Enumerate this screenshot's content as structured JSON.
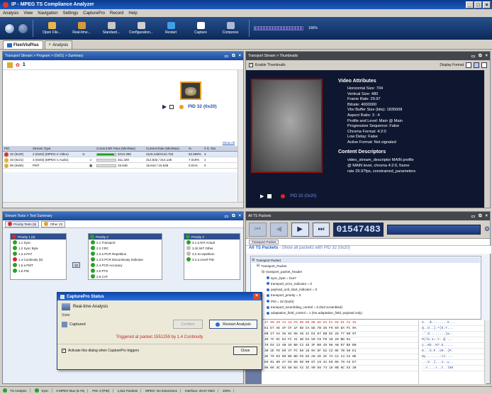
{
  "window": {
    "title": "IP - MPEG TS Compliance Analyzer"
  },
  "menu": [
    "Analysis",
    "View",
    "Navigation",
    "Settings",
    "CapturePro",
    "Record",
    "Help"
  ],
  "toolbar": {
    "buttons": [
      {
        "label": "Open File...",
        "icon": "folder-icon",
        "color": "#e8b64a"
      },
      {
        "label": "Real-time...",
        "icon": "realtime-icon",
        "color": "#d59a3a"
      },
      {
        "label": "Standard...",
        "icon": "standard-icon",
        "color": "#c9c9c9"
      },
      {
        "label": "Configuration...",
        "icon": "configuration-icon",
        "color": "#d0d0d0"
      },
      {
        "label": "Restart",
        "icon": "restart-icon",
        "color": "#3fa0e8"
      },
      {
        "label": "Capture",
        "icon": "capture-icon",
        "color": "#ffffff"
      },
      {
        "label": "Compress",
        "icon": "compress-icon",
        "color": "#aeb9d6"
      }
    ],
    "progress_label": "100%"
  },
  "view_tabs": [
    {
      "label": "FlexiViuPlus"
    },
    {
      "label": "Analysis"
    }
  ],
  "summary_panel": {
    "title": "Transport Stream > Program > (0x01) > Summary",
    "program_number": "1",
    "pid_label": "PID 32 (0x20)",
    "show_all": "Show All",
    "columns": [
      "PID",
      "Stream Type",
      "",
      "",
      "Current BR Pass (Min/Max)",
      "Current Rate (Min/Max)",
      "%",
      "# S. Stats"
    ],
    "rows": [
      {
        "status": "#d03a2a",
        "pid": "32 (0x20)",
        "type": "2 (0x02) (MPEG-2 Video)",
        "br": "4013.368",
        "rate": "4115.448/4122.704",
        "pct": "92.599%",
        "cnt": "4"
      },
      {
        "status": "#e0b030",
        "pid": "33 (0x21)",
        "type": "3 (0x03) (MPEG-1 Audio)",
        "br": "311.328",
        "rate": "312.832 / 314.136",
        "pct": "7.019%",
        "cnt": "1"
      },
      {
        "status": "#e0b030",
        "pid": "96 (0x60)",
        "type": "PMT",
        "br": "15.648",
        "rate": "15.644 / 15.648",
        "pct": "0.01%",
        "cnt": "0"
      }
    ],
    "bar_fill": 0.93,
    "bar_color": "#1ea01e"
  },
  "thumbs_panel": {
    "title": "Transport Stream > Thumbnails",
    "enable_label": "Enable Thumbnails",
    "display_format": "Display Format",
    "video_heading": "Video Attributes",
    "attrs": [
      "Horizontal Size: 704",
      "Vertical Size: 480",
      "Frame Rate: 29.97",
      "Bitrate: 4000000",
      "Vbv Buffer Size (bits): 1835008",
      "Aspect Ratio: 3 : 4",
      "Profile and Level: Main @ Main",
      "Progressive Sequence: False",
      "Chroma Format: 4:2:0",
      "Low Delay: False",
      "Active Format: Not signaled"
    ],
    "content_heading": "Content Descriptors",
    "descriptor": "video_stream_descriptor MAIN profile @ MAIN level, chroma 4:2:0, frame rate 29.97fps, constrained_parameters",
    "pid_label": "PID 32 (0x20)"
  },
  "stream_tests": {
    "title": "Stream Tests > Test Summary",
    "tabs": [
      "Priority Tests (5)",
      "Other (0)"
    ],
    "prio1_title": "Priority 1 (5)",
    "prio1": [
      {
        "label": "1.1 Sync",
        "color": "#2aa02a"
      },
      {
        "label": "1.2 Sync Byte",
        "color": "#2aa02a"
      },
      {
        "label": "1.3 a PAT",
        "color": "#2aa02a"
      },
      {
        "label": "1.4 Continuity (5)",
        "color": "#d02a2a"
      },
      {
        "label": "1.5 a PMT",
        "color": "#2aa02a"
      },
      {
        "label": "1.6 PID",
        "color": "#2aa02a"
      }
    ],
    "prio2_title": "Priority 2",
    "prio2": [
      {
        "label": "2.1 Transport",
        "color": "#2aa02a"
      },
      {
        "label": "2.2 CRC",
        "color": "#2aa02a"
      },
      {
        "label": "2.3 a PCR Repetition",
        "color": "#2aa02a"
      },
      {
        "label": "2.3 b PCR Discontinuity Indicator",
        "color": "#2aa02a"
      },
      {
        "label": "2.4 PCR Accuracy",
        "color": "#2aa02a"
      },
      {
        "label": "2.5 PTS",
        "color": "#2aa02a"
      },
      {
        "label": "2.6 CAT",
        "color": "#2aa02a"
      }
    ],
    "prio3_title": "Priority 3",
    "prio3": [
      {
        "label": "3.1 a NIT Actual",
        "color": "#2aa02a"
      },
      {
        "label": "3.1b NIT Other",
        "color": "#bbbbbb"
      },
      {
        "label": "3.2 SI repetition",
        "color": "#bbbbbb"
      },
      {
        "label": "3.4 a Unref PID",
        "color": "#2aa02a"
      }
    ],
    "badge": "15"
  },
  "packets_panel": {
    "title": "All TS Packets",
    "counter": "01547483",
    "subtab": "Transport Packet",
    "heading": "All TS Packets",
    "heading_sub": " - Show all packets with PID 32 (0x20)",
    "tree": [
      {
        "text": "Transport Packet",
        "depth": 0,
        "sel": true
      },
      {
        "text": "Transport_Packet",
        "depth": 1
      },
      {
        "text": "transport_packet_header",
        "depth": 2
      },
      {
        "text": "sync_byte = 0x47",
        "depth": 3
      },
      {
        "text": "transport_error_indicator = 0",
        "depth": 3
      },
      {
        "text": "payload_unit_start_indicator = 0",
        "depth": 3
      },
      {
        "text": "transport_priority = 0",
        "depth": 3
      },
      {
        "text": "PID = 32 (0x20)",
        "depth": 3
      },
      {
        "text": "transport_scrambling_control = 0 (Not scrambled)",
        "depth": 3
      },
      {
        "text": "adaptation_field_control = 1 (No adaptation_field, payload only)",
        "depth": 3
      }
    ],
    "hex": [
      {
        "off": "0000",
        "bytes": "47 00 20 14 24 FD 00 00 9B 5D D4 E1 58 01 A1 1E",
        "ascii": "G. .$........X..."
      },
      {
        "off": "0010",
        "bytes": "51 E7 AE 4F CF 1F 5D CA 5E 7B 35 F9 59 8A FC 0A",
        "ascii": "Q..O..].^{5.Y..."
      },
      {
        "off": "0020",
        "bytes": "8B 27 AA 36 0A 85 AD 1C D4 07 EB DC 28 77 80 97",
        "ascii": ".'.6........(w.."
      },
      {
        "off": "0030",
        "bytes": "4D 7C 5C 62 FC 31 3D D4 59 C9 FD 40 20 BD 91",
        "ascii": "M|\\b.1=.Y..@ ..."
      },
      {
        "off": "0040",
        "bytes": "79 D4 13 4B 45 B0 C2 4E 3F B0 45 06 AB 07 B5 B0",
        "ascii": "y..KE..N?.E....."
      },
      {
        "off": "0050",
        "bytes": "30 2E FD 89 47 FC 50 18 0A 6F 52 C2 0E 7B 50 E1",
        "ascii": "0...G.P..oR..{P."
      },
      {
        "off": "0060",
        "bytes": "4E 79 D3 00 B9 BD FD 04 A0 2D 3C 7A C2 14 C2 0E",
        "ascii": "Ny.......-<z...."
      },
      {
        "off": "0070",
        "bytes": "E9 01 80 47 D3 06 5D 09 87 19 31 E0 08 79 A2 E7",
        "ascii": "...G..]...1..y.."
      },
      {
        "off": "0080",
        "bytes": "05 06 3C 03 88 B4 A2 3C 90 98 74 16 0B 6C 53 30",
        "ascii": "..<....<..t..lS0"
      }
    ]
  },
  "dialog": {
    "title": "CapturePro Status",
    "subtitle": "Real-time Analysis",
    "state_label": "State",
    "captured": "Captured",
    "confirm": "Confirm",
    "restart": "Restart Analysis",
    "triggered": "Triggered at packet 1551259 by 1.4 Continuity",
    "activate": "Activate this dialog when CapturePro triggers",
    "close": "Close"
  },
  "statusbar": [
    "TS Analysis",
    "Sync",
    "0 MPEG Mux (6.76)",
    "PID: 3 (PID)",
    "1,521 Packets",
    "MPEG: No Extensions",
    "Interface: 28.67 KB/s",
    "100%"
  ]
}
